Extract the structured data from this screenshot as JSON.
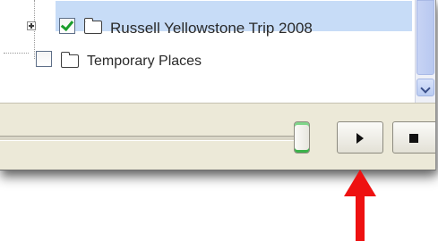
{
  "places_tree": {
    "items": [
      {
        "label": "Russell Yellowstone Trip 2008",
        "checked": true,
        "expanded": false,
        "selected": true,
        "icon": "folder-icon"
      },
      {
        "label": "Temporary Places",
        "checked": false,
        "selected": false,
        "icon": "folder-icon"
      }
    ]
  },
  "tour_controls": {
    "slider_position": 0.97,
    "play_icon": "play-icon",
    "stop_icon": "stop-icon"
  },
  "annotation": {
    "arrow_color": "#ee1111",
    "arrow_target": "play-button"
  },
  "colors": {
    "selection_bg": "#c7dcf7",
    "toolbar_bg": "#ece9d8",
    "check_green": "#1a9d2b"
  }
}
